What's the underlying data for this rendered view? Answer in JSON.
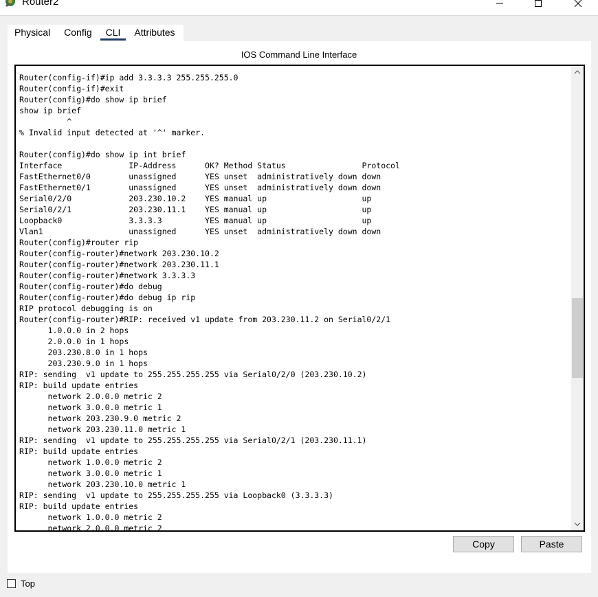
{
  "window": {
    "title": "Router2"
  },
  "tabs": [
    {
      "label": "Physical",
      "active": false
    },
    {
      "label": "Config",
      "active": false
    },
    {
      "label": "CLI",
      "active": true
    },
    {
      "label": "Attributes",
      "active": false
    }
  ],
  "cli": {
    "heading": "IOS Command Line Interface",
    "output": "Router(config-if)#ip add 3.3.3.3 255.255.255.0\nRouter(config-if)#exit\nRouter(config)#do show ip brief\nshow ip brief\n          ^\n% Invalid input detected at '^' marker.\n\nRouter(config)#do show ip int brief\nInterface              IP-Address      OK? Method Status                Protocol\nFastEthernet0/0        unassigned      YES unset  administratively down down\nFastEthernet0/1        unassigned      YES unset  administratively down down\nSerial0/2/0            203.230.10.2    YES manual up                    up\nSerial0/2/1            203.230.11.1    YES manual up                    up\nLoopback0              3.3.3.3         YES manual up                    up\nVlan1                  unassigned      YES unset  administratively down down\nRouter(config)#router rip\nRouter(config-router)#network 203.230.10.2\nRouter(config-router)#network 203.230.11.1\nRouter(config-router)#network 3.3.3.3\nRouter(config-router)#do debug\nRouter(config-router)#do debug ip rip\nRIP protocol debugging is on\nRouter(config-router)#RIP: received v1 update from 203.230.11.2 on Serial0/2/1\n      1.0.0.0 in 2 hops\n      2.0.0.0 in 1 hops\n      203.230.8.0 in 1 hops\n      203.230.9.0 in 1 hops\nRIP: sending  v1 update to 255.255.255.255 via Serial0/2/0 (203.230.10.2)\nRIP: build update entries\n      network 2.0.0.0 metric 2\n      network 3.0.0.0 metric 1\n      network 203.230.9.0 metric 2\n      network 203.230.11.0 metric 1\nRIP: sending  v1 update to 255.255.255.255 via Serial0/2/1 (203.230.11.1)\nRIP: build update entries\n      network 1.0.0.0 metric 2\n      network 3.0.0.0 metric 1\n      network 203.230.10.0 metric 1\nRIP: sending  v1 update to 255.255.255.255 via Loopback0 (3.3.3.3)\nRIP: build update entries\n      network 1.0.0.0 metric 2\n      network 2.0.0.0 metric 2"
  },
  "buttons": {
    "copy": "Copy",
    "paste": "Paste"
  },
  "top_checkbox": {
    "label": "Top",
    "checked": false
  },
  "icons": {
    "app": "router-app-icon",
    "minimize": "minimize-icon",
    "maximize": "maximize-icon",
    "close": "close-icon",
    "scroll_up": "chevron-up-icon",
    "scroll_down": "chevron-down-icon"
  },
  "colors": {
    "tab_underline": "#1f3a5f",
    "window_bg": "#f0f0f0"
  }
}
